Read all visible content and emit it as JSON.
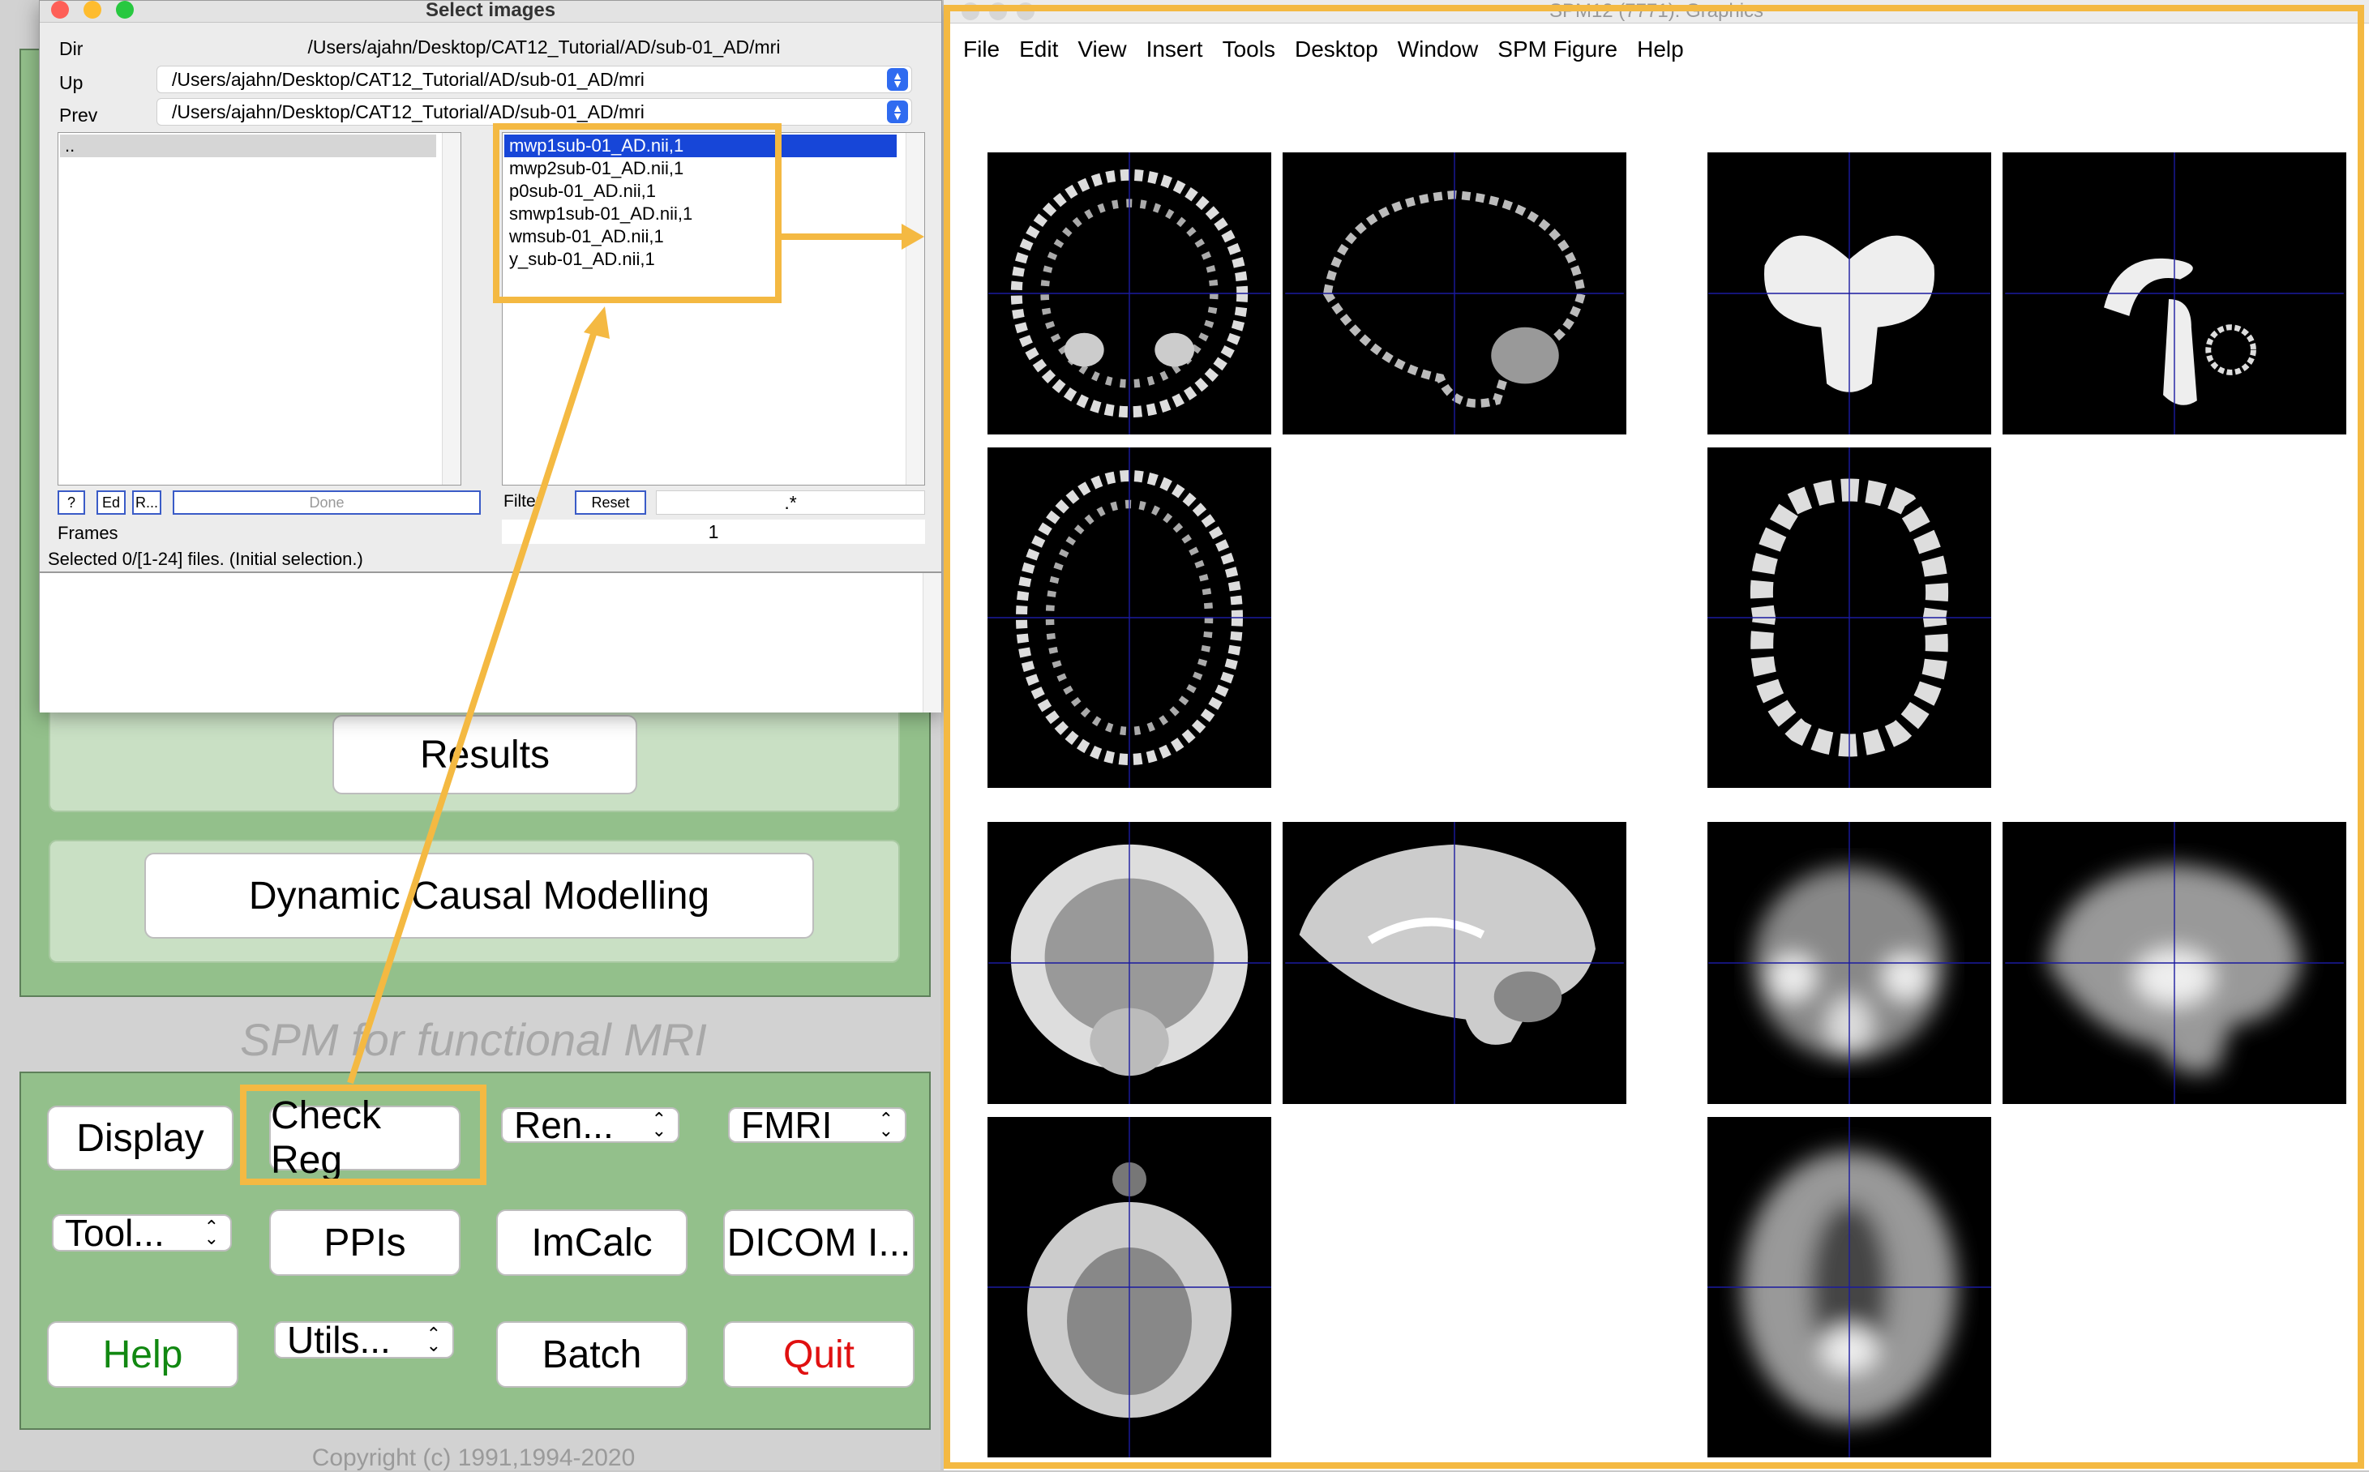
{
  "select_dialog": {
    "title": "Select images",
    "dir_label": "Dir",
    "dir_value": "/Users/ajahn/Desktop/CAT12_Tutorial/AD/sub-01_AD/mri",
    "up_label": "Up",
    "up_value": "/Users/ajahn/Desktop/CAT12_Tutorial/AD/sub-01_AD/mri",
    "prev_label": "Prev",
    "prev_value": "/Users/ajahn/Desktop/CAT12_Tutorial/AD/sub-01_AD/mri",
    "dir_list": [
      ".."
    ],
    "files": [
      "mwp1sub-01_AD.nii,1",
      "mwp2sub-01_AD.nii,1",
      "p0sub-01_AD.nii,1",
      "smwp1sub-01_AD.nii,1",
      "wmsub-01_AD.nii,1",
      "y_sub-01_AD.nii,1"
    ],
    "selected_file_index": 0,
    "btn_help": "?",
    "btn_ed": "Ed",
    "btn_r": "R...",
    "btn_done": "Done",
    "filter_label": "Filter",
    "btn_reset": "Reset",
    "filter_value": ".*",
    "frames_label": "Frames",
    "frames_value": "1",
    "status": "Selected 0/[1-24] files. (Initial selection.)"
  },
  "spm_menu": {
    "results_label": "Results",
    "dcm_label": "Dynamic Causal Modelling",
    "subtitle": "SPM for functional MRI",
    "buttons": {
      "display": "Display",
      "check_reg": "Check Reg",
      "render": "Ren...",
      "fmri": "FMRI",
      "toolbox": "Tool...",
      "ppis": "PPIs",
      "imcalc": "ImCalc",
      "dicom": "DICOM I...",
      "help": "Help",
      "utils": "Utils...",
      "batch": "Batch",
      "quit": "Quit"
    },
    "copyright": "Copyright (c) 1991,1994-2020",
    "colors": {
      "help": "#118811",
      "quit": "#e01010",
      "panel": "#93c08b"
    }
  },
  "graphics_window": {
    "title": "SPM12 (7771): Graphics",
    "menu": [
      "File",
      "Edit",
      "View",
      "Insert",
      "Tools",
      "Desktop",
      "Window",
      "SPM Figure",
      "Help"
    ]
  },
  "annotation_color": "#f4b942"
}
